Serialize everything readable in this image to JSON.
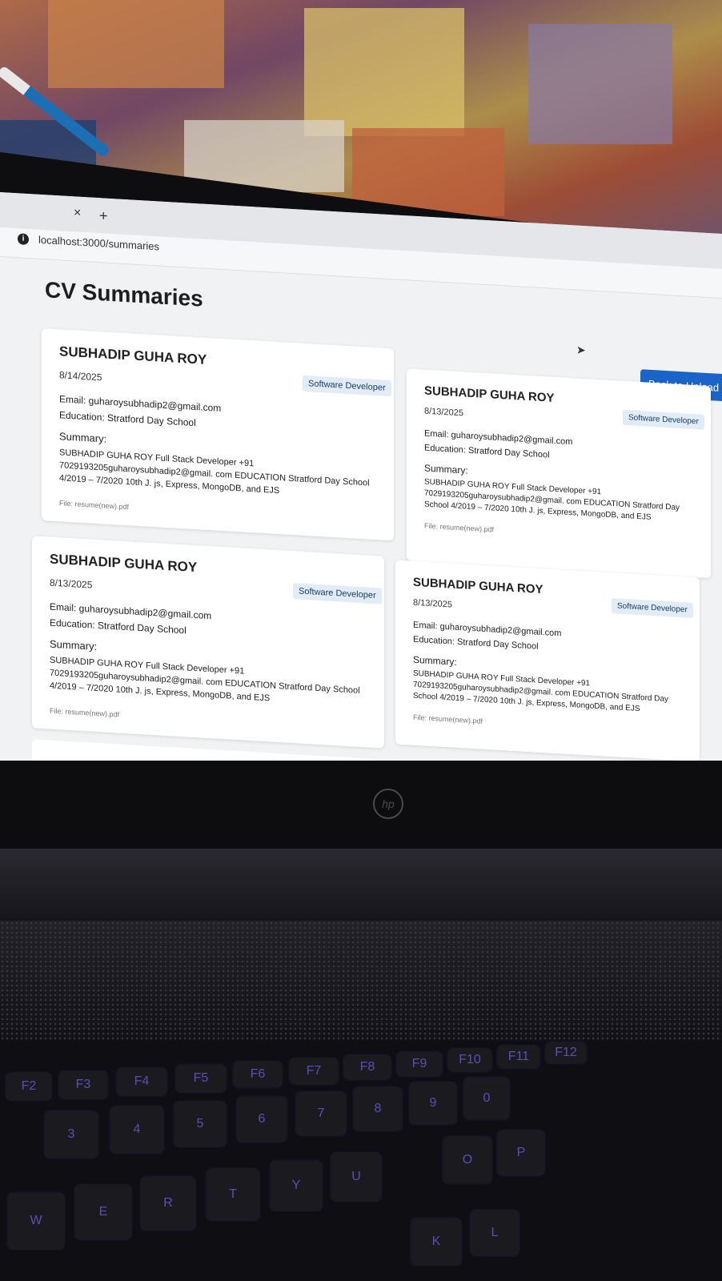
{
  "browser": {
    "tab_close_glyph": "×",
    "new_tab_glyph": "+",
    "url": "localhost:3000/summaries"
  },
  "page": {
    "title": "CV Summaries",
    "back_button_label": "Back to Upload"
  },
  "cards": [
    {
      "name": "SUBHADIP GUHA ROY",
      "date": "8/14/2025",
      "role": "Software Developer",
      "email": "Email: guharoysubhadip2@gmail.com",
      "education": "Education: Stratford Day School",
      "summary_heading": "Summary:",
      "summary_text": "SUBHADIP GUHA ROY Full Stack Developer +91 7029193205guharoysubhadip2@gmail. com EDUCATION Stratford Day School 4/2019 – 7/2020 10th J. js, Express, MongoDB, and EJS",
      "file": "File: resume(new).pdf"
    },
    {
      "name": "SUBHADIP GUHA ROY",
      "date": "8/13/2025",
      "role": "Software Developer",
      "email": "Email: guharoysubhadip2@gmail.com",
      "education": "Education: Stratford Day School",
      "summary_heading": "Summary:",
      "summary_text": "SUBHADIP GUHA ROY Full Stack Developer +91 7029193205guharoysubhadip2@gmail. com EDUCATION Stratford Day School 4/2019 – 7/2020 10th J. js, Express, MongoDB, and EJS",
      "file": "File: resume(new).pdf"
    },
    {
      "name": "SUBHADIP GUHA ROY",
      "date": "8/13/2025",
      "role": "Software Developer",
      "email": "Email: guharoysubhadip2@gmail.com",
      "education": "Education: Stratford Day School",
      "summary_heading": "Summary:",
      "summary_text": "SUBHADIP GUHA ROY Full Stack Developer +91 7029193205guharoysubhadip2@gmail. com EDUCATION Stratford Day School 4/2019 – 7/2020 10th J. js, Express, MongoDB, and EJS",
      "file": "File: resume(new).pdf"
    },
    {
      "name": "SUBHADIP GUHA ROY",
      "date": "8/13/2025",
      "role": "Software Developer",
      "email": "Email: guharoysubhadip2@gmail.com",
      "education": "Education: Stratford Day School",
      "summary_heading": "Summary:",
      "summary_text": "SUBHADIP GUHA ROY Full Stack Developer +91 7029193205guharoysubhadip2@gmail. com EDUCATION Stratford Day School 4/2019 – 7/2020 10th J. js, Express, MongoDB, and EJS",
      "file": "File: resume(new).pdf"
    }
  ],
  "laptop": {
    "logo_text": "hp",
    "keys": [
      "F2",
      "F3",
      "F4",
      "F5",
      "F6",
      "F7",
      "F8",
      "F9",
      "F10",
      "F11",
      "F12",
      "3",
      "4",
      "5",
      "6",
      "7",
      "8",
      "9",
      "0",
      "W",
      "E",
      "R",
      "T",
      "Y",
      "U",
      "O",
      "P",
      "K",
      "L"
    ]
  },
  "colors": {
    "accent": "#1a64c8",
    "badge_bg": "#e2ecf7",
    "keyboard_backlight": "#5a4fb8"
  }
}
